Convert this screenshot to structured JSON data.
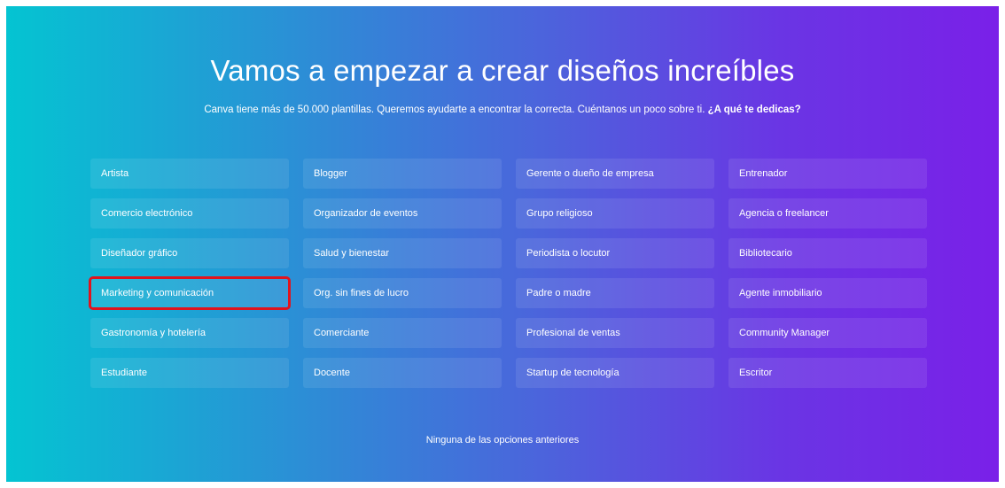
{
  "hero": {
    "title": "Vamos a empezar a crear diseños increíbles",
    "subtitle": "Canva tiene más de 50.000 plantillas. Queremos ayudarte a encontrar la correcta. Cuéntanos un poco sobre ti. ",
    "question": "¿A qué te dedicas?"
  },
  "options": [
    "Artista",
    "Blogger",
    "Gerente o dueño de empresa",
    "Entrenador",
    "Comercio electrónico",
    "Organizador de eventos",
    "Grupo religioso",
    "Agencia o freelancer",
    "Diseñador gráfico",
    "Salud y bienestar",
    "Periodista o locutor",
    "Bibliotecario",
    "Marketing y comunicación",
    "Org. sin fines de lucro",
    "Padre o madre",
    "Agente inmobiliario",
    "Gastronomía y hotelería",
    "Comerciante",
    "Profesional de ventas",
    "Community Manager",
    "Estudiante",
    "Docente",
    "Startup de tecnología",
    "Escritor"
  ],
  "highlighted_option": "Marketing y comunicación",
  "none_option": "Ninguna de las opciones anteriores",
  "colors": {
    "gradient_start": "#04c4d2",
    "gradient_end": "#7a20e8",
    "highlight_border": "#e0141e"
  }
}
